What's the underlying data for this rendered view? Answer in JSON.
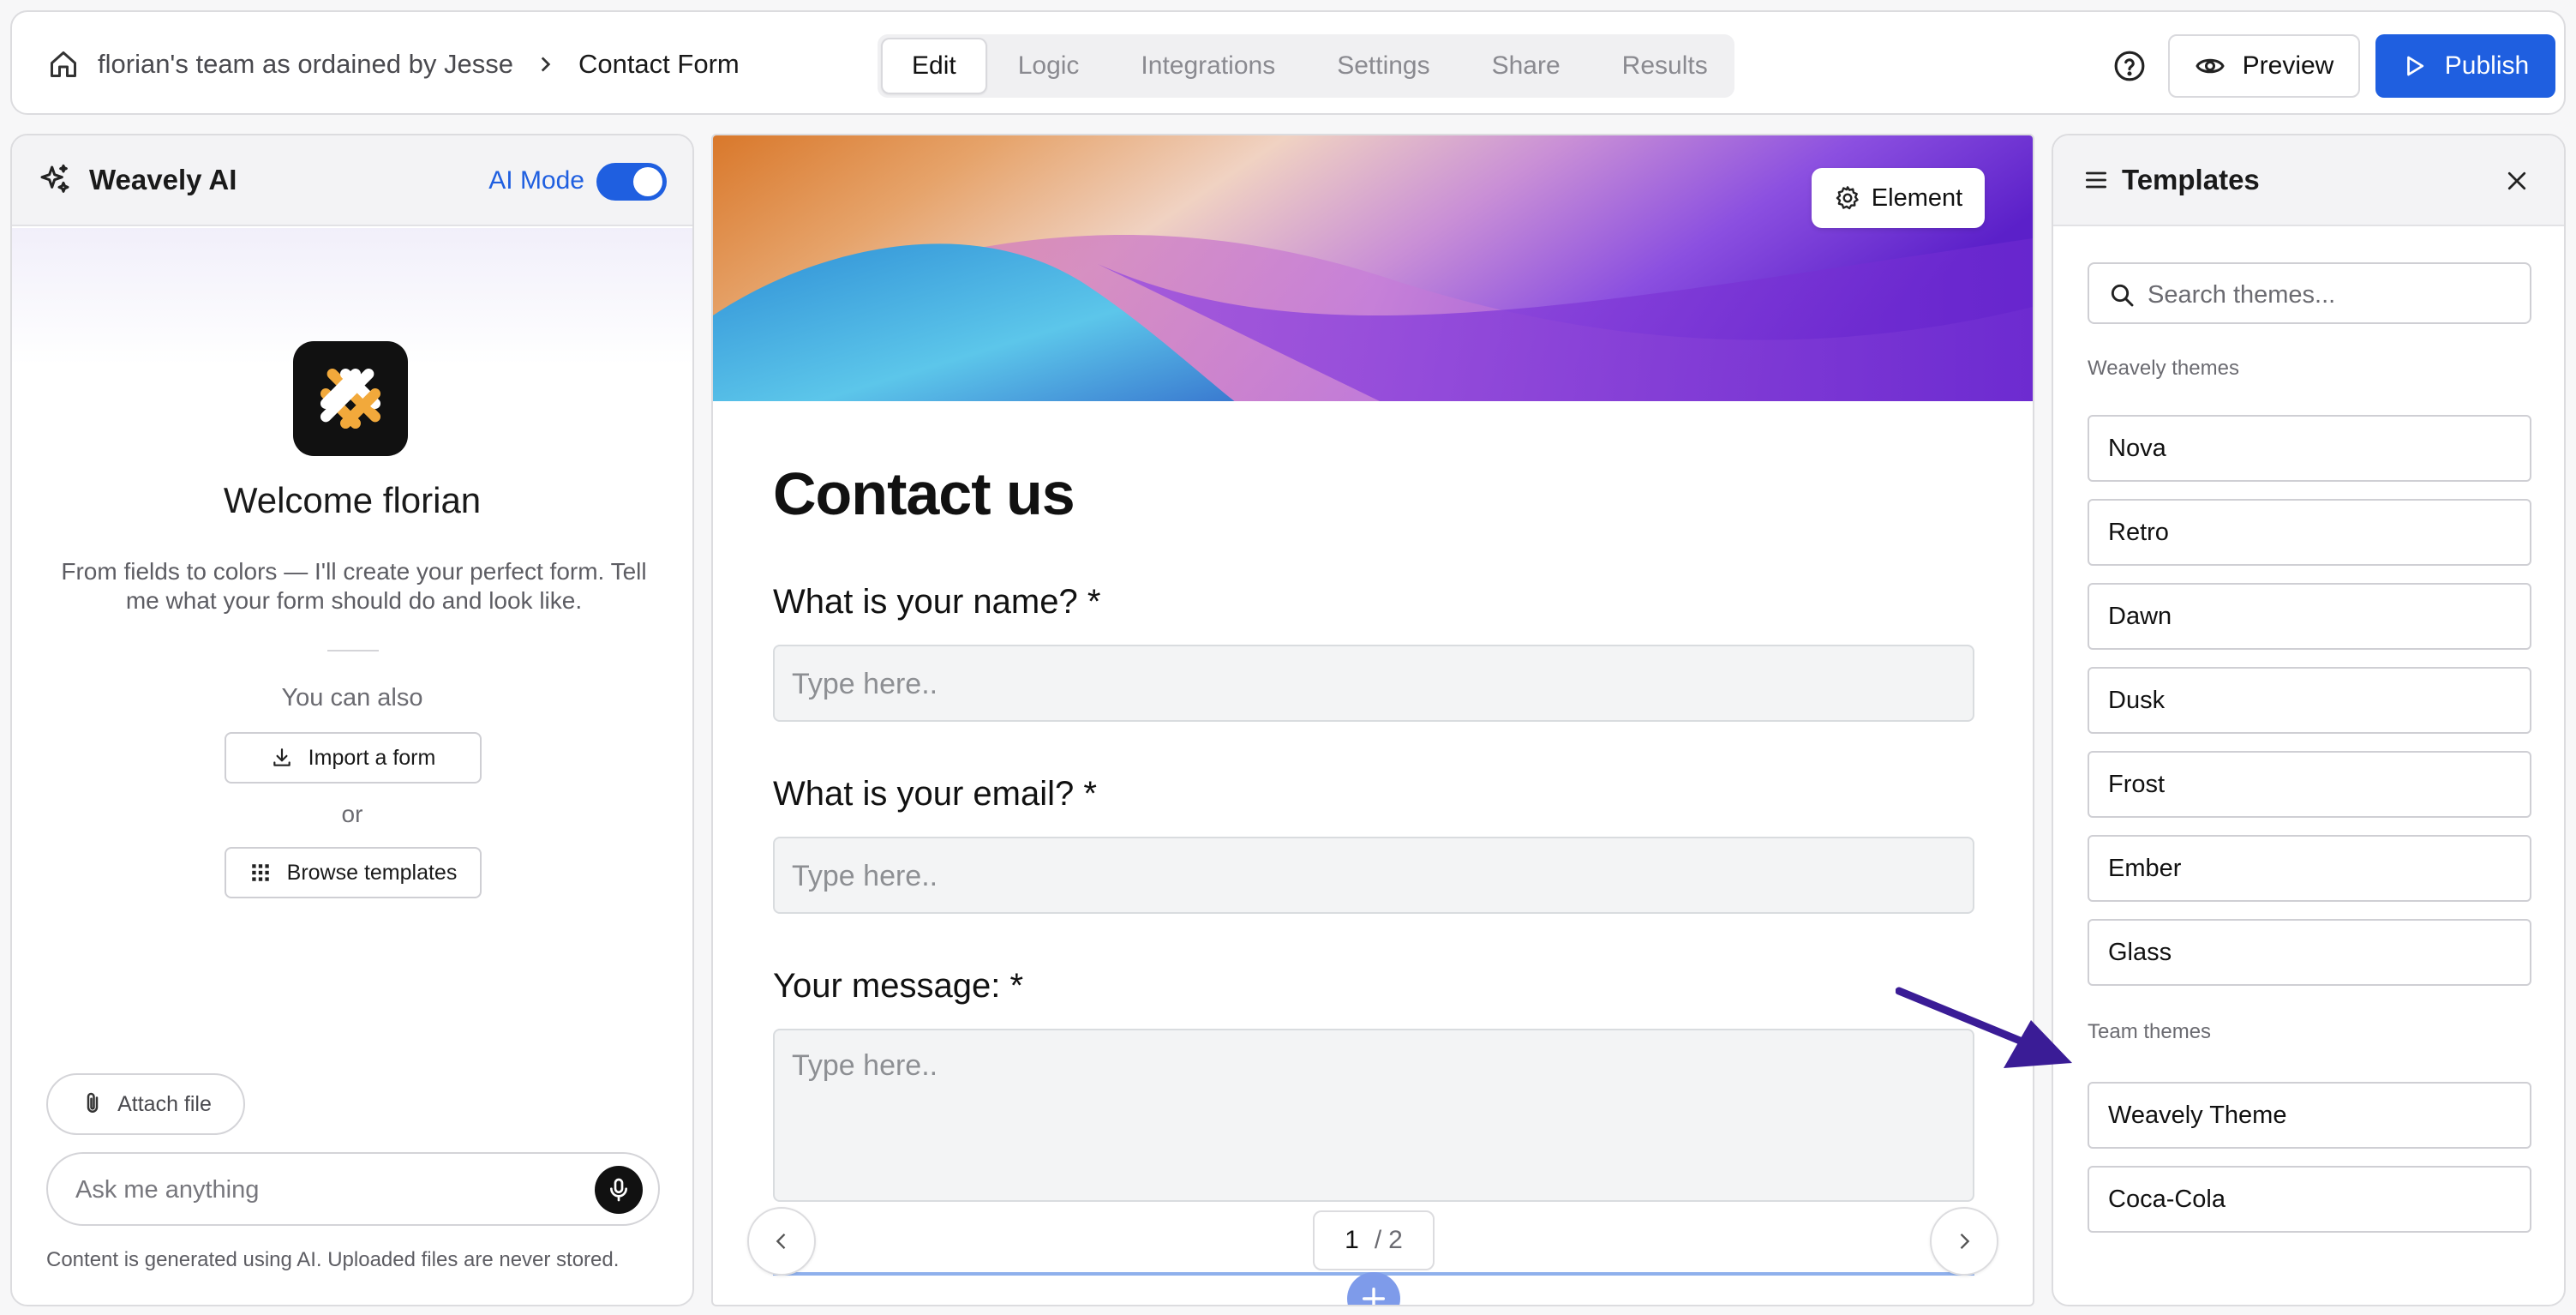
{
  "breadcrumb": {
    "team": "florian's team as ordained by Jesse",
    "page": "Contact Form"
  },
  "tabs": [
    {
      "label": "Edit",
      "active": true
    },
    {
      "label": "Logic",
      "active": false
    },
    {
      "label": "Integrations",
      "active": false
    },
    {
      "label": "Settings",
      "active": false
    },
    {
      "label": "Share",
      "active": false
    },
    {
      "label": "Results",
      "active": false
    }
  ],
  "header": {
    "preview_label": "Preview",
    "publish_label": "Publish"
  },
  "ai_panel": {
    "title": "Weavely AI",
    "ai_mode_label": "AI Mode",
    "ai_mode_on": true,
    "welcome": "Welcome florian",
    "description": "From fields to colors — I'll create your perfect form. Tell me what your form should do and look like.",
    "you_can_also": "You can also",
    "import_label": "Import a form",
    "or_label": "or",
    "browse_label": "Browse templates",
    "attach_label": "Attach file",
    "ask_placeholder": "Ask me anything",
    "disclaimer": "Content is generated using AI. Uploaded files are never stored."
  },
  "form": {
    "element_label": "Element",
    "title": "Contact us",
    "questions": [
      {
        "label": "What is your name? *",
        "placeholder": "Type here.."
      },
      {
        "label": "What is your email? *",
        "placeholder": "Type here.."
      },
      {
        "label": "Your message: *",
        "placeholder": "Type here.."
      }
    ],
    "pager": {
      "current": "1",
      "separator": "/",
      "total": "2"
    }
  },
  "templates": {
    "title": "Templates",
    "search_placeholder": "Search themes...",
    "weavely_section": "Weavely themes",
    "weavely_themes": [
      "Nova",
      "Retro",
      "Dawn",
      "Dusk",
      "Frost",
      "Ember",
      "Glass"
    ],
    "team_section": "Team themes",
    "team_themes": [
      "Weavely Theme",
      "Coca-Cola"
    ]
  },
  "colors": {
    "accent": "#1f5fe0",
    "annotation_arrow": "#3a1c96"
  }
}
